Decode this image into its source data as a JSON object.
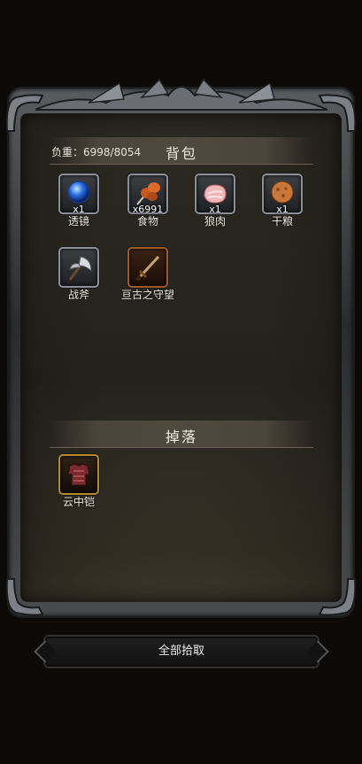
{
  "inventory": {
    "weight_label": "负重：",
    "weight_value": "6998/8054",
    "title": "背包",
    "items": [
      {
        "name": "透镜",
        "qty": "x1",
        "icon": "blue-orb-icon"
      },
      {
        "name": "食物",
        "qty": "x6991",
        "icon": "meat-skewer-icon"
      },
      {
        "name": "狼肉",
        "qty": "x1",
        "icon": "raw-meat-icon"
      },
      {
        "name": "干粮",
        "qty": "x1",
        "icon": "bread-icon"
      },
      {
        "name": "战斧",
        "qty": "",
        "icon": "battle-axe-icon"
      },
      {
        "name": "亘古之守望",
        "qty": "",
        "icon": "sword-icon"
      }
    ]
  },
  "drops": {
    "title": "掉落",
    "items": [
      {
        "name": "云中铠",
        "qty": "",
        "icon": "armor-icon"
      }
    ]
  },
  "actions": {
    "pick_all": "全部拾取"
  },
  "colors": {
    "frame_silver": "#8c8f95",
    "gold_border": "#b28a2a",
    "orange_border": "#9b5b25",
    "panel_bg": "#2c2922"
  }
}
